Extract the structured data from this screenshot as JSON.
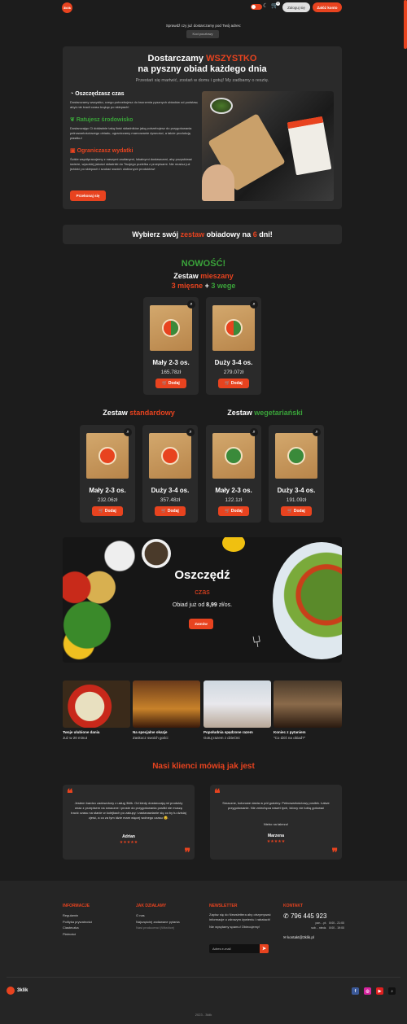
{
  "header": {
    "logo_text": "3klik",
    "cart_count": "0",
    "login_label": "Zaloguj się",
    "register_label": "Załóż konto"
  },
  "delivery": {
    "question": "Sprawdź czy już dostarczamy pod Twój adres:",
    "postal_placeholder": "Kod pocztowy"
  },
  "hero": {
    "title_prefix": "Dostarczamy",
    "title_highlight": "WSZYSTKO",
    "title_line2": "na pyszny obiad każdego dnia",
    "subtitle": "Przestań się martwić, zostań w domu i gotuj! My zadbamy o resztę.",
    "features": [
      {
        "title": "Oszczędzasz czas",
        "text": "Dostarczamy wszystko, czego potrzebujesz do tworzenia pysznych obiadów od podstaw, abyś nie tracił czasu krążąc po sklepach!"
      },
      {
        "title": "Ratujesz środowisko",
        "text": "Dostarczając Ci dokładnie taką ilość składników jaką potrzebujesz do przygotowania pełnowartościowego obiadu, ograniczamy marnowanie żywności, a także produkcję plastiku!"
      },
      {
        "title": "Ograniczasz wydatki",
        "text": "Ściśle współpracujemy z naszymi zaufanymi, lokalnymi dostawcami, aby pozyskiwać świeże, wysokiej jakości składniki do Twojego pudełka z przepisami. Nie musisz już jeździć po sklepach i szukać swoich ulubionych produktów!"
      }
    ],
    "cta_label": "Przekonaj się"
  },
  "choose": {
    "prefix": "Wybierz swój",
    "highlight": "zestaw",
    "middle": "obiadowy na",
    "days": "6",
    "suffix": "dni!"
  },
  "mixed": {
    "new_label": "NOWOŚĆ!",
    "title_prefix": "Zestaw",
    "title_highlight": "mieszany",
    "meat": "3 mięsne",
    "plus": "+",
    "veg": "3 wege"
  },
  "standard_title": {
    "prefix": "Zestaw",
    "highlight": "standardowy"
  },
  "vege_title": {
    "prefix": "Zestaw",
    "highlight": "wegetariański"
  },
  "add_label": "Dodaj",
  "products": {
    "mixed_small": {
      "name": "Mały 2-3 os.",
      "price": "165.78zł"
    },
    "mixed_large": {
      "name": "Duży 3-4 os.",
      "price": "279.07zł"
    },
    "std_small": {
      "name": "Mały 2-3 os.",
      "price": "232.06zł"
    },
    "std_large": {
      "name": "Duży 3-4 os.",
      "price": "357.48zł"
    },
    "veg_small": {
      "name": "Mały 2-3 os.",
      "price": "122.1zł"
    },
    "veg_large": {
      "name": "Duży 3-4 os.",
      "price": "191.09zł"
    }
  },
  "save_banner": {
    "title": "Oszczędź",
    "subtitle": "czas",
    "text_prefix": "Obiad już od",
    "price": "8,99",
    "text_suffix": "zł/os.",
    "cta": "Zamów"
  },
  "occasions": [
    {
      "title": "Twoje ulubione dania",
      "subtitle": "Już w 20 minut"
    },
    {
      "title": "Na specjalne okazje",
      "subtitle": "Zaskocz swoich gości"
    },
    {
      "title": "Popołudnia spędzone razem",
      "subtitle": "Gotuj razem z dziećmi"
    },
    {
      "title": "Koniec z pytaniem",
      "subtitle": "\"Co dziś na obiad?\""
    }
  ],
  "testimonials": {
    "title": "Nasi klienci mówią jak jest",
    "items": [
      {
        "text": "Jestem bardzo zadowolony z usług 3klik. Od kiedy dostarczają mi produkty wraz z przepisem na smaczne i proste do przygotowania posiłki nie muszę tracić czasu na stanie w kolejkach po zakupy i zastanawianie się co by tu dzisiaj zjeść, a co za tym idzie mam więcej wolnego czasu 😊.",
        "name": "Adrian",
        "stars": "★★★★★"
      },
      {
        "text": "Smaczne, kolorowe dania w pół godziny. Pełnowartościowy posiłek. Łatwe przygotowanie. Nie zniechęca nawet tych, którzy nie lubią gotować",
        "text2": "Niebo na talerzu!",
        "name": "Marzena",
        "stars": "★★★★★"
      }
    ]
  },
  "footer": {
    "info": {
      "title": "Informacje",
      "links": [
        "Regulamin",
        "Polityka prywatności",
        "Ciasteczka",
        "Płatności"
      ]
    },
    "how": {
      "title": "Jak działamy",
      "links": [
        "O nas",
        "Najczęściej zadawane pytania",
        "Nasi producenci (Wkrótce)"
      ]
    },
    "newsletter": {
      "title": "Newsletter",
      "text": "Zapisz się do Newslettera aby otrzymywać informacje o zdrowym żywieniu i rabatach!",
      "note": "Nie wysyłamy spamu! Obiecujemy!",
      "placeholder": "Adres e-mail"
    },
    "contact": {
      "title": "Kontakt",
      "phone": "796 445 923",
      "hours": [
        {
          "days": "pon. - pt.",
          "time": "8:00 - 21:00"
        },
        {
          "days": "sob. - niedz.",
          "time": "8:00 - 19:00"
        }
      ],
      "email": "kontakt@3klik.pl"
    },
    "brand": "3klik",
    "copyright": "2023 - 3klik"
  },
  "colors": {
    "accent": "#e8431f",
    "green": "#3aa33a",
    "bg": "#1c1c1c",
    "card": "#2a2a2a"
  }
}
